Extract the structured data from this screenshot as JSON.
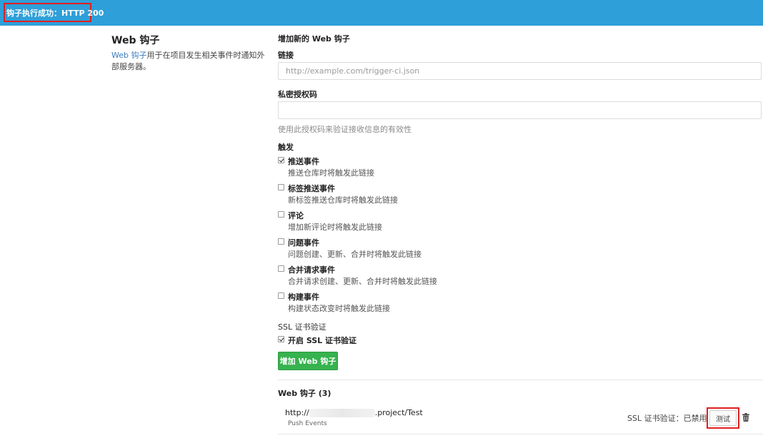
{
  "flash": {
    "message": "钩子执行成功：HTTP 200"
  },
  "sidebar": {
    "title": "Web 钩子",
    "desc_link": "Web 钩子",
    "desc_rest": "用于在项目发生相关事件时通知外部服务器。"
  },
  "form": {
    "heading": "增加新的 Web 钩子",
    "url_label": "链接",
    "url_placeholder": "http://example.com/trigger-ci.json",
    "url_value": "",
    "token_label": "私密授权码",
    "token_value": "",
    "token_help": "使用此授权码来验证接收信息的有效性",
    "triggers_label": "触发",
    "triggers": [
      {
        "label": "推送事件",
        "desc": "推送仓库时将触发此链接",
        "checked": true
      },
      {
        "label": "标签推送事件",
        "desc": "新标签推送仓库时将触发此链接",
        "checked": false
      },
      {
        "label": "评论",
        "desc": "增加新评论时将触发此链接",
        "checked": false
      },
      {
        "label": "问题事件",
        "desc": "问题创建、更新、合并时将触发此链接",
        "checked": false
      },
      {
        "label": "合并请求事件",
        "desc": "合并请求创建、更新、合并时将触发此链接",
        "checked": false
      },
      {
        "label": "构建事件",
        "desc": "构建状态改变时将触发此链接",
        "checked": false
      }
    ],
    "ssl_label": "SSL 证书验证",
    "ssl_checkbox_label": "开启 SSL 证书验证",
    "ssl_checked": true,
    "submit_label": "增加 Web 钩子"
  },
  "hooks": {
    "heading": "Web 钩子 (3)",
    "items": [
      {
        "url_prefix": "http://",
        "url_suffix": ".project/Test",
        "events": "Push Events",
        "ssl_status": "SSL 证书验证：已禁用",
        "test_label": "测试"
      }
    ]
  }
}
